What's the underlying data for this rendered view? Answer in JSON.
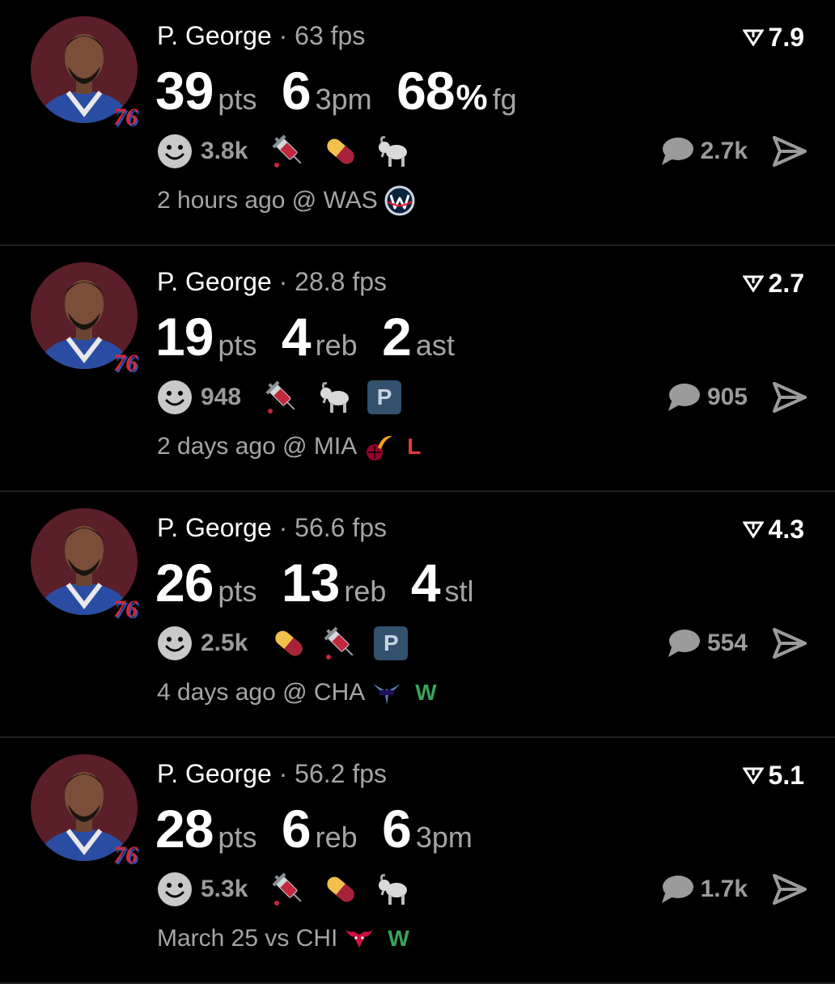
{
  "colors": {
    "loss": "#e23b3b",
    "win": "#3aa35a",
    "muted": "#a5a5a5",
    "badge": "#33506d"
  },
  "cards": [
    {
      "player": "P. George",
      "separator": "·",
      "fps": "63 fps",
      "rating": "7.9",
      "team_logo": "76",
      "stats": [
        {
          "num": "39",
          "unit": "pts"
        },
        {
          "num": "6",
          "unit": "3pm"
        },
        {
          "num": "68",
          "pct": "%",
          "unit": "fg"
        }
      ],
      "reaction_count": "3.8k",
      "reaction_icons": [
        "syringe-icon",
        "pill-icon",
        "goat-icon"
      ],
      "comment_count": "2.7k",
      "footer_text": "2 hours ago @ WAS",
      "opponent_logo": "wizards-logo",
      "result": ""
    },
    {
      "player": "P. George",
      "separator": "·",
      "fps": "28.8 fps",
      "rating": "2.7",
      "team_logo": "76",
      "stats": [
        {
          "num": "19",
          "unit": "pts"
        },
        {
          "num": "4",
          "unit": "reb"
        },
        {
          "num": "2",
          "unit": "ast"
        }
      ],
      "reaction_count": "948",
      "reaction_icons": [
        "syringe-icon",
        "goat-icon",
        "parking-icon"
      ],
      "parking_label": "P",
      "comment_count": "905",
      "footer_text": "2 days ago @ MIA",
      "opponent_logo": "heat-logo",
      "result": "L"
    },
    {
      "player": "P. George",
      "separator": "·",
      "fps": "56.6 fps",
      "rating": "4.3",
      "team_logo": "76",
      "stats": [
        {
          "num": "26",
          "unit": "pts"
        },
        {
          "num": "13",
          "unit": "reb"
        },
        {
          "num": "4",
          "unit": "stl"
        }
      ],
      "reaction_count": "2.5k",
      "reaction_icons": [
        "pill-icon",
        "syringe-icon",
        "parking-icon"
      ],
      "parking_label": "P",
      "comment_count": "554",
      "footer_text": "4 days ago @ CHA",
      "opponent_logo": "hornets-logo",
      "result": "W"
    },
    {
      "player": "P. George",
      "separator": "·",
      "fps": "56.2 fps",
      "rating": "5.1",
      "team_logo": "76",
      "stats": [
        {
          "num": "28",
          "unit": "pts"
        },
        {
          "num": "6",
          "unit": "reb"
        },
        {
          "num": "6",
          "unit": "3pm"
        }
      ],
      "reaction_count": "5.3k",
      "reaction_icons": [
        "syringe-icon",
        "pill-icon",
        "goat-icon"
      ],
      "comment_count": "1.7k",
      "footer_text": "March 25 vs CHI",
      "opponent_logo": "bulls-logo",
      "result": "W"
    }
  ]
}
